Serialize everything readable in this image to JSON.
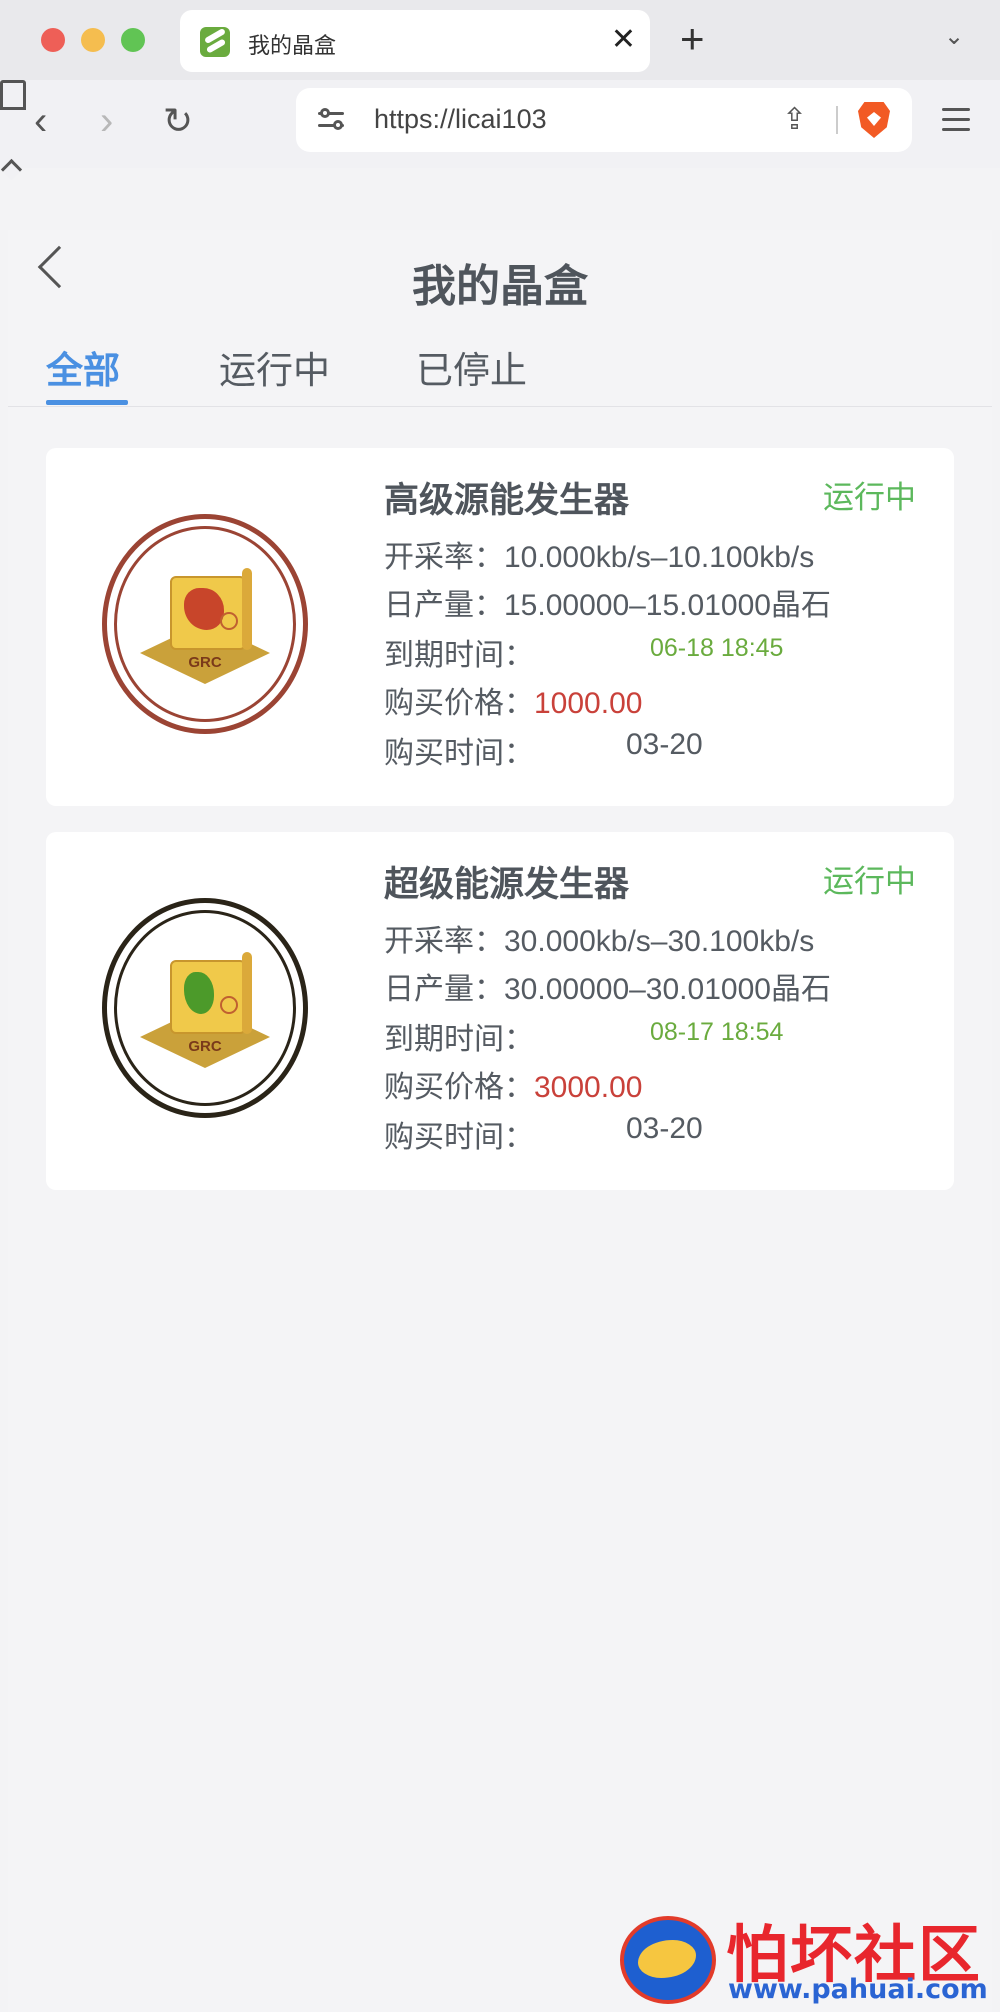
{
  "browser": {
    "tab_title": "我的晶盒",
    "url": "https://licai103"
  },
  "page": {
    "title": "我的晶盒",
    "tabs": [
      "全部",
      "运行中",
      "已停止"
    ]
  },
  "cards": [
    {
      "name": "高级源能发生器",
      "status": "运行中",
      "rate_label": "开采率：",
      "rate_value": "10.000kb/s–10.100kb/s",
      "daily_label": "日产量：",
      "daily_value": "15.00000–15.01000晶石",
      "expiry_label": "到期时间：",
      "expiry_value": "06-18 18:45",
      "price_label": "购买价格：",
      "price_value": "1000.00",
      "buytime_label": "购买时间：",
      "buytime_value": "03-20",
      "image_text": "GRC"
    },
    {
      "name": "超级能源发生器",
      "status": "运行中",
      "rate_label": "开采率：",
      "rate_value": "30.000kb/s–30.100kb/s",
      "daily_label": "日产量：",
      "daily_value": "30.00000–30.01000晶石",
      "expiry_label": "到期时间：",
      "expiry_value": "08-17 18:54",
      "price_label": "购买价格：",
      "price_value": "3000.00",
      "buytime_label": "购买时间：",
      "buytime_value": "03-20",
      "image_text": "GRC"
    }
  ],
  "watermark": {
    "text": "怕坏社区",
    "url": "www.pahuai.com"
  },
  "colors": {
    "accent": "#4a90e2",
    "status": "#5cb85c",
    "price": "#c9413a",
    "expiry": "#6aab3e"
  }
}
